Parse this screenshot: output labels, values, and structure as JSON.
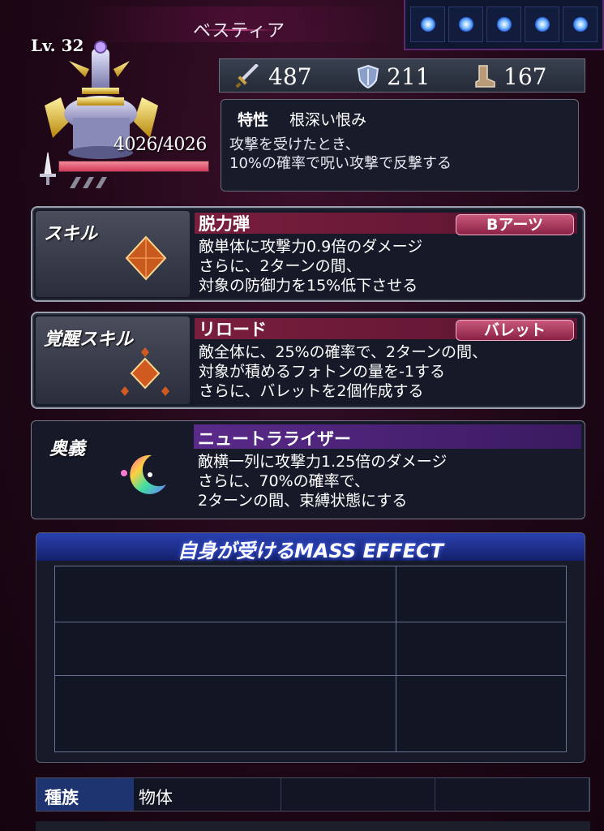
{
  "unit": {
    "name": "ベスティア",
    "level": "Lv. 32",
    "hp_text": "4026/4026",
    "hp_fraction": 1.0
  },
  "stats": {
    "attack": "487",
    "defense": "211",
    "speed": "167",
    "attack_icon": "sword-icon",
    "defense_icon": "shield-icon",
    "speed_icon": "boot-icon"
  },
  "trait": {
    "label": "特性",
    "name": "根深い恨み",
    "desc_lines": [
      "攻撃を受けたとき、",
      "10%の確率で呪い攻撃で反撃する"
    ]
  },
  "skill": {
    "label": "スキル",
    "name": "脱力弾",
    "tag": "Bアーツ",
    "desc_lines": [
      "敵単体に攻撃力0.9倍のダメージ",
      "さらに、2ターンの間、",
      "対象の防御力を15%低下させる"
    ]
  },
  "awaken": {
    "label": "覚醒スキル",
    "name": "リロード",
    "tag": "バレット",
    "desc_lines": [
      "敵全体に、25%の確率で、2ターンの間、",
      "対象が積めるフォトンの量を-1する",
      "さらに、バレットを2個作成する"
    ]
  },
  "ougi": {
    "label": "奥義",
    "name": "ニュートラライザー",
    "desc_lines": [
      "敵横一列に攻撃力1.25倍のダメージ",
      "さらに、70%の確率で、",
      "2ターンの間、束縛状態にする"
    ]
  },
  "mass_effect": {
    "title": "自身が受けるMASS EFFECT"
  },
  "species": {
    "label": "種族",
    "value": "物体"
  },
  "colors": {
    "background": "#1e0716",
    "skill_title": "#7a1e3e",
    "ougi_title": "#5a2a8a",
    "mass_header": "#2a40b0",
    "orb": "#6fb4ff"
  }
}
